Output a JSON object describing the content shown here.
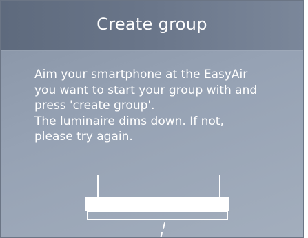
{
  "header": {
    "title": "Create group"
  },
  "instructions": {
    "lines": [
      "Aim your smartphone at the EasyAir",
      "you want to start your group with and",
      "press 'create group'.",
      "The luminaire dims down. If not,",
      "please try again."
    ]
  },
  "illustration": {
    "icon": "luminaire-icon",
    "beam": "dashed-ir-beam"
  },
  "colors": {
    "header_bg": "#6a768a",
    "body_bg": "#96a2b4",
    "text": "#ffffff"
  }
}
